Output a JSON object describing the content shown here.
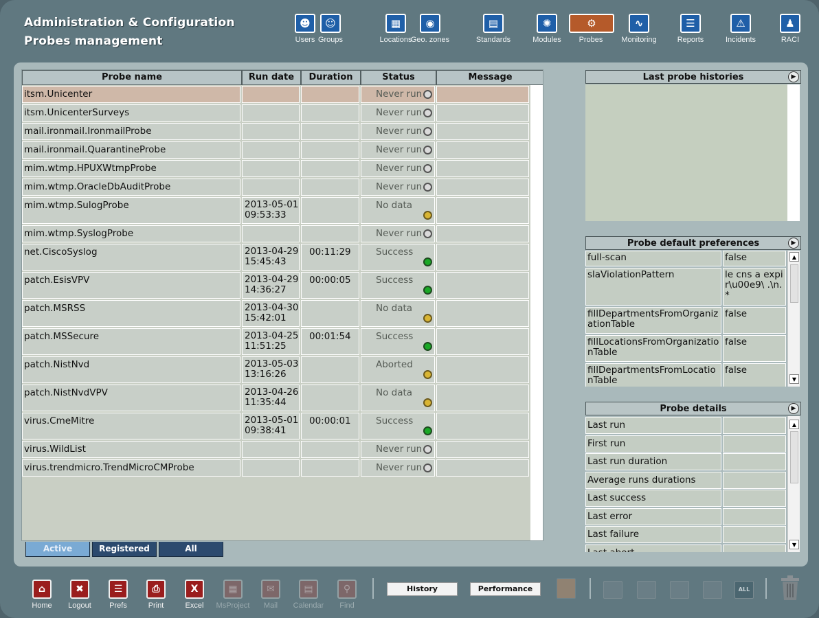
{
  "header": {
    "title_line1": "Administration & Configuration",
    "title_line2": "Probes management",
    "nav": [
      {
        "label": "Users",
        "icon": "user-icon"
      },
      {
        "label": "Groups",
        "icon": "group-icon"
      },
      {
        "label": "Locations",
        "icon": "building-icon"
      },
      {
        "label": "Geo. zones",
        "icon": "globe-icon"
      },
      {
        "label": "Standards",
        "icon": "document-icon"
      },
      {
        "label": "Modules",
        "icon": "modules-icon"
      },
      {
        "label": "Probes",
        "icon": "probes-icon"
      },
      {
        "label": "Monitoring",
        "icon": "monitoring-icon"
      },
      {
        "label": "Reports",
        "icon": "report-icon"
      },
      {
        "label": "Incidents",
        "icon": "warning-icon"
      },
      {
        "label": "RACI",
        "icon": "people-icon"
      }
    ]
  },
  "table": {
    "columns": [
      "Probe name",
      "Run date",
      "Duration",
      "Status",
      "Message"
    ],
    "rows": [
      {
        "name": "itsm.Unicenter",
        "date1": "",
        "date2": "",
        "duration": "",
        "status": "Never run",
        "dot": "grey",
        "selected": true
      },
      {
        "name": "itsm.UnicenterSurveys",
        "date1": "",
        "date2": "",
        "duration": "",
        "status": "Never run",
        "dot": "grey"
      },
      {
        "name": "mail.ironmail.IronmailProbe",
        "date1": "",
        "date2": "",
        "duration": "",
        "status": "Never run",
        "dot": "grey"
      },
      {
        "name": "mail.ironmail.QuarantineProbe",
        "date1": "",
        "date2": "",
        "duration": "",
        "status": "Never run",
        "dot": "grey"
      },
      {
        "name": "mim.wtmp.HPUXWtmpProbe",
        "date1": "",
        "date2": "",
        "duration": "",
        "status": "Never run",
        "dot": "grey"
      },
      {
        "name": "mim.wtmp.OracleDbAuditProbe",
        "date1": "",
        "date2": "",
        "duration": "",
        "status": "Never run",
        "dot": "grey"
      },
      {
        "name": "mim.wtmp.SulogProbe",
        "date1": "2013-05-01",
        "date2": "09:53:33",
        "duration": "",
        "status": "No data",
        "dot": "yellow"
      },
      {
        "name": "mim.wtmp.SyslogProbe",
        "date1": "",
        "date2": "",
        "duration": "",
        "status": "Never run",
        "dot": "grey"
      },
      {
        "name": "net.CiscoSyslog",
        "date1": "2013-04-29",
        "date2": "15:45:43",
        "duration": "00:11:29",
        "status": "Success",
        "dot": "green"
      },
      {
        "name": "patch.EsisVPV",
        "date1": "2013-04-29",
        "date2": "14:36:27",
        "duration": "00:00:05",
        "status": "Success",
        "dot": "green"
      },
      {
        "name": "patch.MSRSS",
        "date1": "2013-04-30",
        "date2": "15:42:01",
        "duration": "",
        "status": "No data",
        "dot": "yellow"
      },
      {
        "name": "patch.MSSecure",
        "date1": "2013-04-25",
        "date2": "11:51:25",
        "duration": "00:01:54",
        "status": "Success",
        "dot": "green"
      },
      {
        "name": "patch.NistNvd",
        "date1": "2013-05-03",
        "date2": "13:16:26",
        "duration": "",
        "status": "Aborted",
        "dot": "yellow"
      },
      {
        "name": "patch.NistNvdVPV",
        "date1": "2013-04-26",
        "date2": "11:35:44",
        "duration": "",
        "status": "No data",
        "dot": "yellow"
      },
      {
        "name": "virus.CmeMitre",
        "date1": "2013-05-01",
        "date2": "09:38:41",
        "duration": "00:00:01",
        "status": "Success",
        "dot": "green"
      },
      {
        "name": "virus.WildList",
        "date1": "",
        "date2": "",
        "duration": "",
        "status": "Never run",
        "dot": "grey"
      },
      {
        "name": "virus.trendmicro.TrendMicroCMProbe",
        "date1": "",
        "date2": "",
        "duration": "",
        "status": "Never run",
        "dot": "grey"
      }
    ]
  },
  "tabs": {
    "active": "Active",
    "registered": "Registered",
    "all": "All"
  },
  "histories": {
    "title": "Last probe histories"
  },
  "preferences": {
    "title": "Probe default preferences",
    "rows": [
      {
        "key": "full-scan",
        "value": "false"
      },
      {
        "key": "slaViolationPattern",
        "value": "le cns a expir\\u00e9\\ .\\n.*"
      },
      {
        "key": "fillDepartmentsFromOrganizationTable",
        "value": "false"
      },
      {
        "key": "fillLocationsFromOrganizationTable",
        "value": "false"
      },
      {
        "key": "fillDepartmentsFromLocationTable",
        "value": "false"
      }
    ]
  },
  "details": {
    "title": "Probe details",
    "rows": [
      "Last run",
      "First run",
      "Last run duration",
      "Average runs durations",
      "Last success",
      "Last error",
      "Last failure",
      "Last abort"
    ]
  },
  "toolbar": {
    "buttons": [
      {
        "label": "Home",
        "icon": "home-icon",
        "enabled": true
      },
      {
        "label": "Logout",
        "icon": "logout-icon",
        "enabled": true
      },
      {
        "label": "Prefs",
        "icon": "prefs-icon",
        "enabled": true
      },
      {
        "label": "Print",
        "icon": "print-icon",
        "enabled": true
      },
      {
        "label": "Excel",
        "icon": "excel-icon",
        "enabled": true
      },
      {
        "label": "MsProject",
        "icon": "msproject-icon",
        "enabled": false
      },
      {
        "label": "Mail",
        "icon": "mail-icon",
        "enabled": false
      },
      {
        "label": "Calendar",
        "icon": "calendar-icon",
        "enabled": false
      },
      {
        "label": "Find",
        "icon": "find-icon",
        "enabled": false
      }
    ],
    "history_label": "History",
    "performance_label": "Performance",
    "all_label": "ALL"
  }
}
